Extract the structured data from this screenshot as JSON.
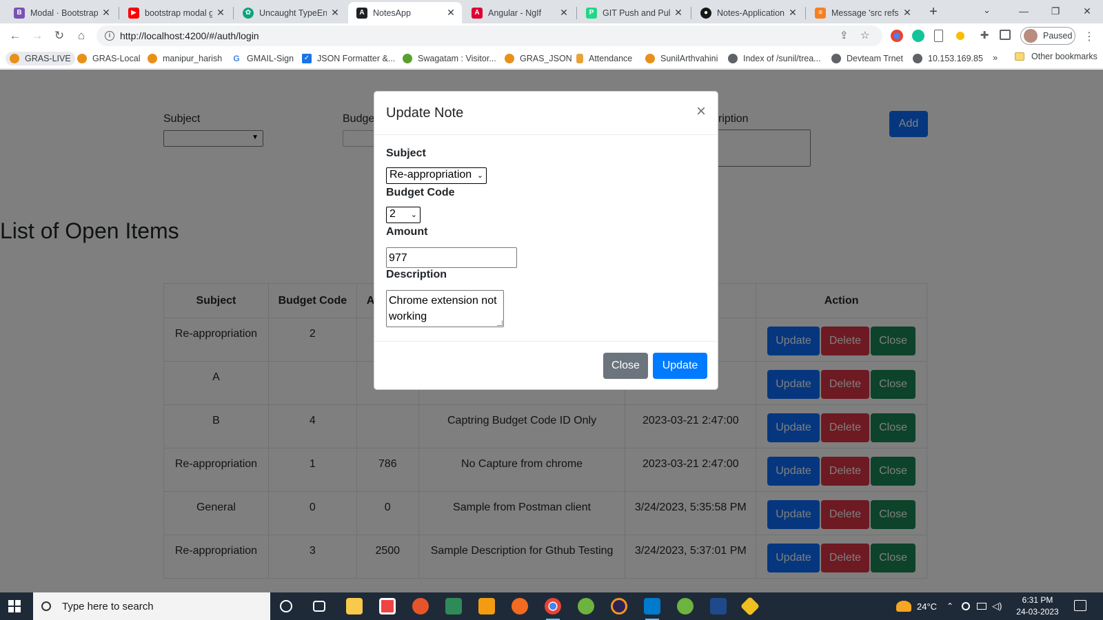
{
  "browser": {
    "tabs": [
      {
        "title": "Modal · Bootstrap",
        "icon": "bootstrap-icon",
        "color": "#7952b3"
      },
      {
        "title": "bootstrap modal g",
        "icon": "youtube-icon",
        "color": "#ff0000"
      },
      {
        "title": "Uncaught TypeErro",
        "icon": "chatgpt-icon",
        "color": "#10a37f"
      },
      {
        "title": "NotesApp",
        "icon": "angular-icon",
        "color": "#202124",
        "active": true
      },
      {
        "title": "Angular - NgIf",
        "icon": "angular-icon",
        "color": "#dd0031"
      },
      {
        "title": "GIT Push and Pull T",
        "icon": "pycharm-icon",
        "color": "#21d789"
      },
      {
        "title": "Notes-Application-",
        "icon": "github-icon",
        "color": "#181717"
      },
      {
        "title": "Message 'src refsp",
        "icon": "stackoverflow-icon",
        "color": "#f48024"
      }
    ],
    "url": "http://localhost:4200/#/auth/login",
    "profile_label": "Paused",
    "bookmarks": [
      {
        "label": "GRAS-LIVE",
        "color": "#e8901a"
      },
      {
        "label": "GRAS-Local",
        "color": "#e8901a"
      },
      {
        "label": "manipur_harish",
        "color": "#e8901a"
      },
      {
        "label": "GMAIL-Sign",
        "color": "#4285f4",
        "glyph": "G"
      },
      {
        "label": "JSON Formatter &...",
        "color": "#1a73e8"
      },
      {
        "label": "Swagatam : Visitor...",
        "color": "#5aa02c"
      },
      {
        "label": "GRAS_JSON",
        "color": "#e8901a"
      },
      {
        "label": "Attendance",
        "color": "#e8a23a"
      },
      {
        "label": "SunilArthvahini",
        "color": "#e8901a"
      },
      {
        "label": "Index of /sunil/trea...",
        "color": "#5f6368"
      },
      {
        "label": "Devteam Trnet",
        "color": "#5f6368"
      },
      {
        "label": "10.153.169.85",
        "color": "#5f6368"
      }
    ],
    "bookmarks_more": "»",
    "other_bookmarks": "Other bookmarks"
  },
  "form": {
    "subject_label": "Subject",
    "budget_label": "Budge",
    "description_label": "ription",
    "add_label": "Add"
  },
  "list_heading": "List of Open Items",
  "table": {
    "headers": [
      "Subject",
      "Budget Code",
      "A",
      "",
      "",
      "Action"
    ],
    "rows": [
      {
        "subject": "Re-appropriation",
        "budget": "2",
        "amount": "",
        "description": "",
        "date": "7:00"
      },
      {
        "subject": "A",
        "budget": "",
        "amount": "",
        "description": "",
        "date": "7:00"
      },
      {
        "subject": "B",
        "budget": "4",
        "amount": "",
        "description": "Captring Budget Code ID Only",
        "date": "2023-03-21 2:47:00"
      },
      {
        "subject": "Re-appropriation",
        "budget": "1",
        "amount": "786",
        "description": "No Capture from chrome",
        "date": "2023-03-21 2:47:00"
      },
      {
        "subject": "General",
        "budget": "0",
        "amount": "0",
        "description": "Sample from Postman client",
        "date": "3/24/2023, 5:35:58 PM"
      },
      {
        "subject": "Re-appropriation",
        "budget": "3",
        "amount": "2500",
        "description": "Sample Description for Gthub Testing",
        "date": "3/24/2023, 5:37:01 PM"
      }
    ],
    "action_labels": {
      "update": "Update",
      "delete": "Delete",
      "close": "Close"
    }
  },
  "modal": {
    "title": "Update Note",
    "close_x": "×",
    "subject_label": "Subject",
    "subject_value": "Re-appropriation",
    "budget_label": "Budget Code",
    "budget_value": "2",
    "amount_label": "Amount",
    "amount_value": "977",
    "description_label": "Description",
    "description_value": "Chrome extension not working",
    "close_button": "Close",
    "update_button": "Update"
  },
  "taskbar": {
    "search_placeholder": "Type here to search",
    "temperature": "24°C",
    "time": "6:31 PM",
    "date": "24-03-2023"
  },
  "colors": {
    "primary": "#0d6efd",
    "danger": "#dc3545",
    "success": "#198754",
    "secondary": "#6c757d",
    "modal_update": "#007bff"
  }
}
